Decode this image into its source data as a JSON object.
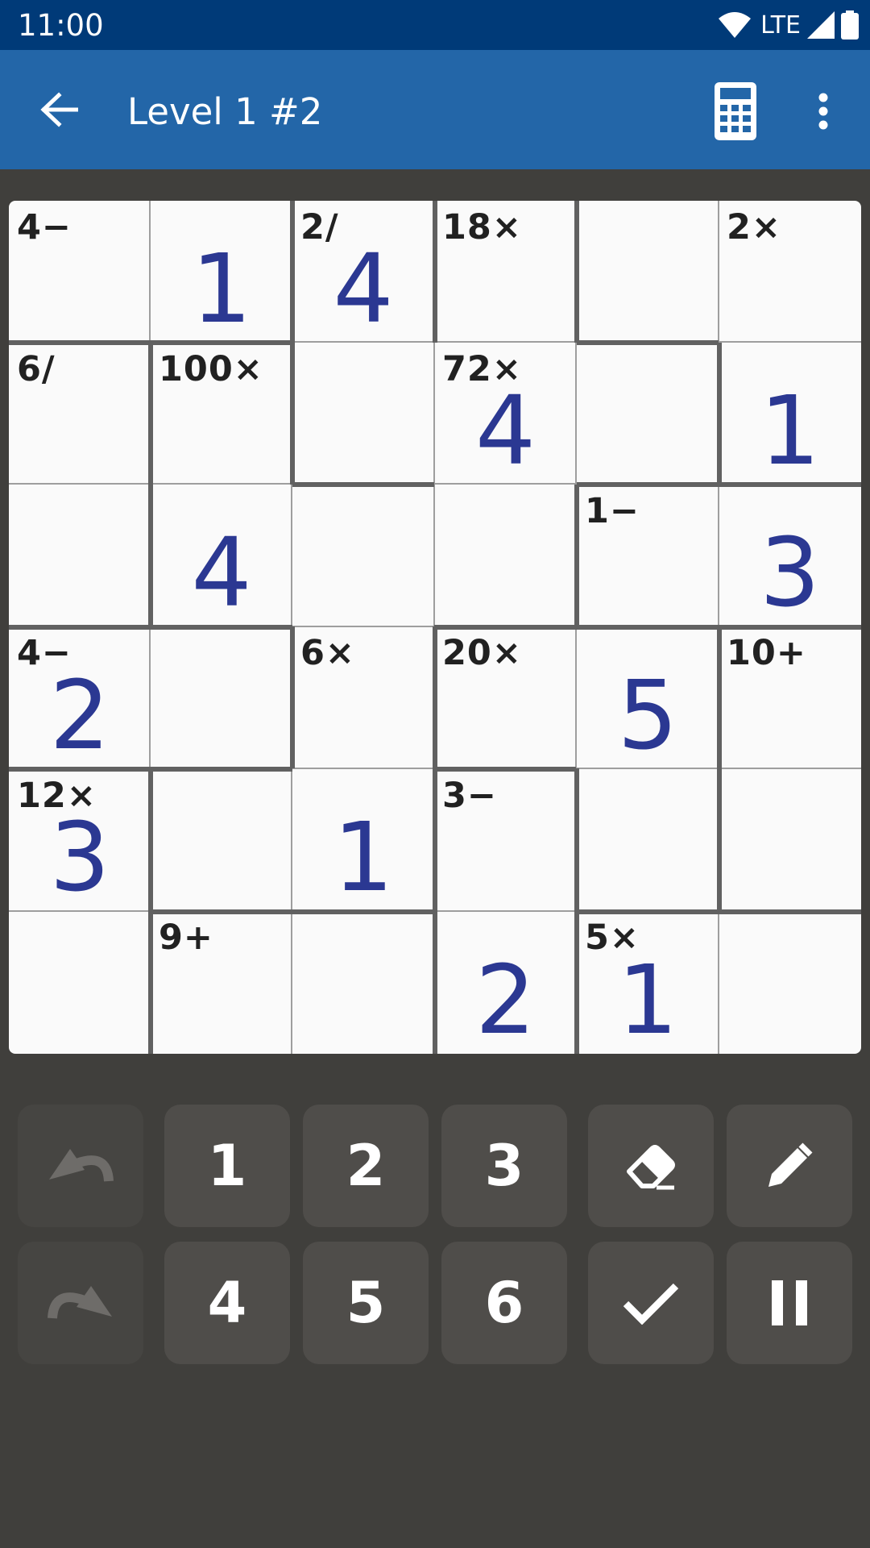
{
  "status": {
    "time": "11:00",
    "network": "LTE"
  },
  "toolbar": {
    "title": "Level 1 #2",
    "back_icon": "arrow-back-icon",
    "calc_icon": "calculator-icon",
    "menu_icon": "more-vert-icon"
  },
  "colors": {
    "status_bar": "#003a78",
    "app_bar": "#2366a8",
    "background": "#403f3c",
    "board": "#fafafa",
    "value_text": "#2b3892",
    "cage_text": "#212121",
    "key_bg": "#4f4d4a"
  },
  "grid": {
    "size": 6,
    "cages": [
      "4−",
      "",
      "2/",
      "18×",
      "",
      "2×",
      "6/",
      "100×",
      "",
      "72×",
      "",
      "",
      "",
      "",
      "",
      "",
      "1−",
      "",
      "4−",
      "",
      "6×",
      "20×",
      "",
      "10+",
      "12×",
      "",
      "",
      "3−",
      "",
      "",
      "",
      "9+",
      "",
      "",
      "5×",
      ""
    ],
    "values": [
      "",
      "1",
      "4",
      "",
      "",
      "",
      "",
      "",
      "",
      "4",
      "",
      "1",
      "",
      "4",
      "",
      "",
      "",
      "3",
      "2",
      "",
      "",
      "",
      "5",
      "",
      "3",
      "",
      "1",
      "",
      "",
      "",
      "",
      "",
      "",
      "2",
      "1",
      ""
    ]
  },
  "keypad": {
    "undo_icon": "undo-icon",
    "redo_icon": "redo-icon",
    "erase_icon": "eraser-icon",
    "pencil_icon": "pencil-icon",
    "check_icon": "check-icon",
    "pause_icon": "pause-icon",
    "digits": [
      "1",
      "2",
      "3",
      "4",
      "5",
      "6"
    ]
  }
}
